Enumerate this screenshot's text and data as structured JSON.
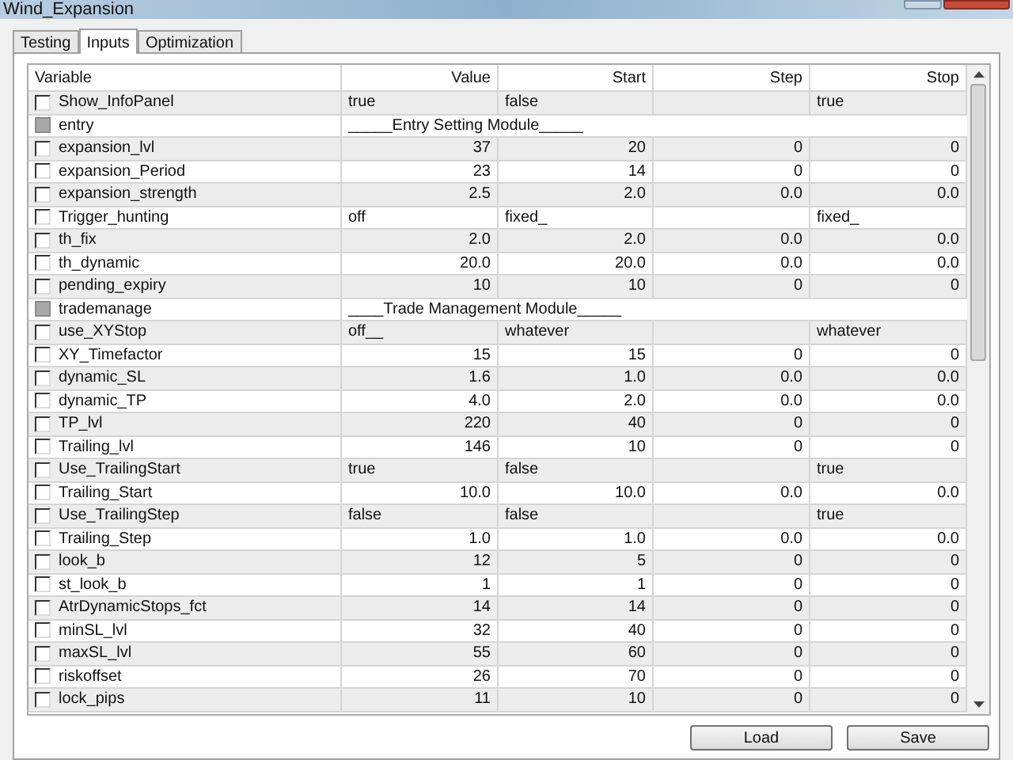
{
  "window": {
    "title": "Wind_Expansion"
  },
  "tabs": [
    {
      "label": "Testing",
      "selected": false
    },
    {
      "label": "Inputs",
      "selected": true
    },
    {
      "label": "Optimization",
      "selected": false
    }
  ],
  "table": {
    "columns": [
      "Variable",
      "Value",
      "Start",
      "Step",
      "Stop"
    ],
    "rows": [
      {
        "kind": "text",
        "name": "Show_InfoPanel",
        "checked": false,
        "value": "true",
        "start": "false",
        "stop": "true"
      },
      {
        "kind": "section",
        "name": "entry",
        "checked": false,
        "value": "_____Entry Setting Module_____"
      },
      {
        "kind": "number",
        "name": "expansion_lvl",
        "checked": false,
        "value": "37",
        "start": "20",
        "step": "0",
        "stop": "0"
      },
      {
        "kind": "number",
        "name": "expansion_Period",
        "checked": false,
        "value": "23",
        "start": "14",
        "step": "0",
        "stop": "0"
      },
      {
        "kind": "number",
        "name": "expansion_strength",
        "checked": false,
        "value": "2.5",
        "start": "2.0",
        "step": "0.0",
        "stop": "0.0"
      },
      {
        "kind": "text",
        "name": "Trigger_hunting",
        "checked": false,
        "value": "off",
        "start": "fixed_",
        "stop": "fixed_"
      },
      {
        "kind": "number",
        "name": "th_fix",
        "checked": false,
        "value": "2.0",
        "start": "2.0",
        "step": "0.0",
        "stop": "0.0"
      },
      {
        "kind": "number",
        "name": "th_dynamic",
        "checked": false,
        "value": "20.0",
        "start": "20.0",
        "step": "0.0",
        "stop": "0.0"
      },
      {
        "kind": "number",
        "name": "pending_expiry",
        "checked": false,
        "value": "10",
        "start": "10",
        "step": "0",
        "stop": "0"
      },
      {
        "kind": "section",
        "name": "trademanage",
        "checked": false,
        "value": "____Trade Management Module_____"
      },
      {
        "kind": "text",
        "name": "use_XYStop",
        "checked": false,
        "value": "off__",
        "start": "whatever",
        "stop": "whatever"
      },
      {
        "kind": "number",
        "name": "XY_Timefactor",
        "checked": false,
        "value": "15",
        "start": "15",
        "step": "0",
        "stop": "0"
      },
      {
        "kind": "number",
        "name": "dynamic_SL",
        "checked": false,
        "value": "1.6",
        "start": "1.0",
        "step": "0.0",
        "stop": "0.0"
      },
      {
        "kind": "number",
        "name": "dynamic_TP",
        "checked": false,
        "value": "4.0",
        "start": "2.0",
        "step": "0.0",
        "stop": "0.0"
      },
      {
        "kind": "number",
        "name": "TP_lvl",
        "checked": false,
        "value": "220",
        "start": "40",
        "step": "0",
        "stop": "0"
      },
      {
        "kind": "number",
        "name": "Trailing_lvl",
        "checked": false,
        "value": "146",
        "start": "10",
        "step": "0",
        "stop": "0"
      },
      {
        "kind": "text",
        "name": "Use_TrailingStart",
        "checked": false,
        "value": "true",
        "start": "false",
        "stop": "true"
      },
      {
        "kind": "number",
        "name": "Trailing_Start",
        "checked": false,
        "value": "10.0",
        "start": "10.0",
        "step": "0.0",
        "stop": "0.0"
      },
      {
        "kind": "text",
        "name": "Use_TrailingStep",
        "checked": false,
        "value": "false",
        "start": "false",
        "stop": "true"
      },
      {
        "kind": "number",
        "name": "Trailing_Step",
        "checked": false,
        "value": "1.0",
        "start": "1.0",
        "step": "0.0",
        "stop": "0.0"
      },
      {
        "kind": "number",
        "name": "look_b",
        "checked": false,
        "value": "12",
        "start": "5",
        "step": "0",
        "stop": "0"
      },
      {
        "kind": "number",
        "name": "st_look_b",
        "checked": false,
        "value": "1",
        "start": "1",
        "step": "0",
        "stop": "0"
      },
      {
        "kind": "number",
        "name": "AtrDynamicStops_fct",
        "checked": false,
        "value": "14",
        "start": "14",
        "step": "0",
        "stop": "0"
      },
      {
        "kind": "number",
        "name": "minSL_lvl",
        "checked": false,
        "value": "32",
        "start": "40",
        "step": "0",
        "stop": "0"
      },
      {
        "kind": "number",
        "name": "maxSL_lvl",
        "checked": false,
        "value": "55",
        "start": "60",
        "step": "0",
        "stop": "0"
      },
      {
        "kind": "number",
        "name": "riskoffset",
        "checked": false,
        "value": "26",
        "start": "70",
        "step": "0",
        "stop": "0"
      },
      {
        "kind": "number",
        "name": "lock_pips",
        "checked": false,
        "value": "11",
        "start": "10",
        "step": "0",
        "stop": "0"
      }
    ]
  },
  "buttons": [
    "Load",
    "Save"
  ]
}
